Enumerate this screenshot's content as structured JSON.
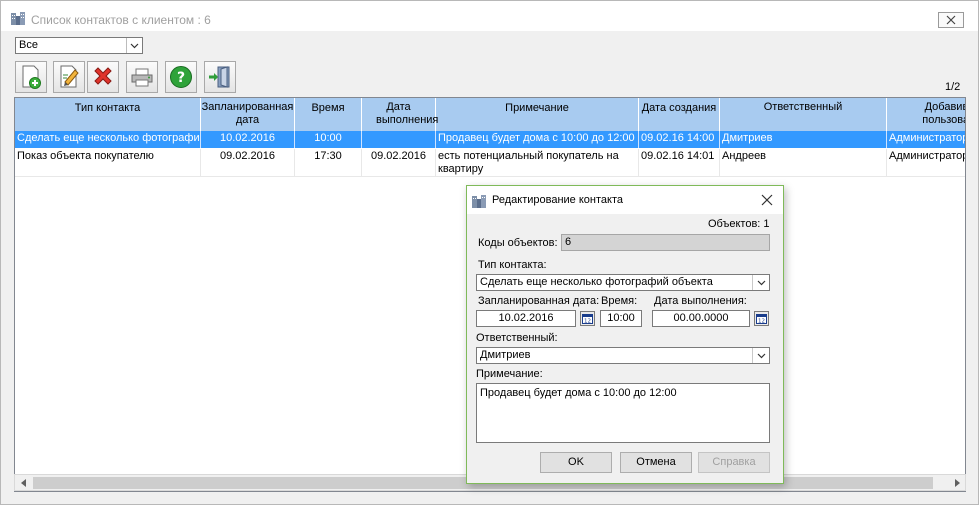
{
  "window": {
    "title": "Список контактов с клиентом : 6"
  },
  "filter": {
    "selected": "Все"
  },
  "toolbar": {
    "buttons": [
      {
        "icon": "add-document-icon"
      },
      {
        "icon": "edit-document-icon"
      },
      {
        "icon": "delete-icon"
      },
      {
        "icon": "printer-icon"
      },
      {
        "icon": "help-icon"
      },
      {
        "icon": "exit-door-icon"
      }
    ]
  },
  "pager": {
    "text": "1/2"
  },
  "grid": {
    "columns": [
      "Тип контакта",
      "Запланированная дата",
      "Время",
      "Дата выполнения",
      "Примечание",
      "Дата создания",
      "Ответственный",
      "Добавивший пользователь"
    ],
    "rows": [
      {
        "type": "Сделать еще несколько фотографий объекта",
        "planned_date": "10.02.2016",
        "time": "10:00",
        "done_date": "",
        "note": "Продавец будет дома с 10:00 до 12:00",
        "created": "09.02.16 14:00",
        "responsible": "Дмитриев",
        "added_by": "Администратор"
      },
      {
        "type": "Показ объекта покупателю",
        "planned_date": "09.02.2016",
        "time": "17:30",
        "done_date": "09.02.2016",
        "note": "есть потенциальный покупатель на квартиру",
        "created": "09.02.16 14:01",
        "responsible": "Андреев",
        "added_by": "Администратор"
      }
    ]
  },
  "dialog": {
    "title": "Редактирование контакта",
    "objects_count": "Объектов: 1",
    "codes_label": "Коды объектов:",
    "codes_value": "6",
    "type_label": "Тип контакта:",
    "type_value": "Сделать еще несколько фотографий объекта",
    "planned_label": "Запланированная дата:",
    "planned_value": "10.02.2016",
    "time_label": "Время:",
    "time_value": "10:00",
    "done_label": "Дата выполнения:",
    "done_value": "00.00.0000",
    "responsible_label": "Ответственный:",
    "responsible_value": "Дмитриев",
    "note_label": "Примечание:",
    "note_value": "Продавец будет дома с 10:00 до 12:00",
    "ok": "OK",
    "cancel": "Отмена",
    "help": "Справка"
  },
  "colors": {
    "header": "#a8cbf0",
    "selection": "#3399ff",
    "dialog_border": "#7fba59"
  }
}
